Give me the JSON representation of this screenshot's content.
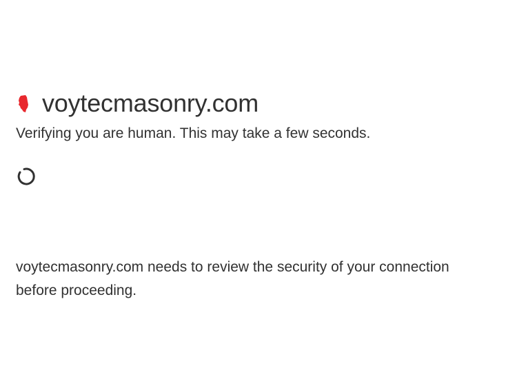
{
  "site": {
    "domain": "voytecmasonry.com",
    "favicon_icon": "illinois-state-shape-icon",
    "favicon_color": "#e8282e"
  },
  "challenge": {
    "verifying_text": "Verifying you are human. This may take a few seconds.",
    "spinner_icon": "loading-spinner-icon",
    "review_text": "voytecmasonry.com needs to review the security of your connection before proceeding."
  },
  "colors": {
    "text": "#313131",
    "background": "#ffffff"
  }
}
